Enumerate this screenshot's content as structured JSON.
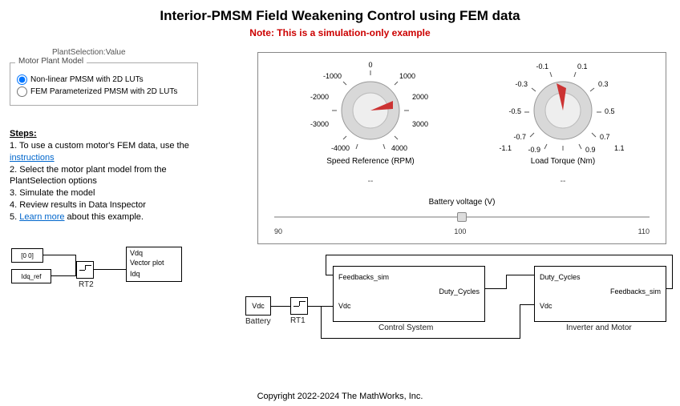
{
  "title": "Interior-PMSM Field Weakening Control using FEM data",
  "subtitle": "Note: This is a simulation-only example",
  "plant_selection_heading": "PlantSelection:Value",
  "plant_group": {
    "title": "Motor Plant Model",
    "options": [
      {
        "label": "Non-linear PMSM with 2D LUTs",
        "checked": true
      },
      {
        "label": "FEM Parameterized PMSM with 2D LUTs",
        "checked": false
      }
    ]
  },
  "steps": {
    "heading": "Steps:",
    "line1a": "1. To use a custom motor's FEM data, use the ",
    "line1_link": "instructions",
    "line2": "2. Select the motor plant model from the PlantSelection options",
    "line3": "3. Simulate the model",
    "line4": "4. Review results in Data Inspector",
    "line5a": "5. ",
    "line5_link": "Learn more",
    "line5b": " about this example."
  },
  "dashboard": {
    "speed_dial": {
      "label": "Speed Reference (RPM)",
      "value_display": "--",
      "ticks": [
        "-1000",
        "0",
        "1000",
        "-2000",
        "2000",
        "-3000",
        "3000",
        "-4000",
        "4000"
      ]
    },
    "torque_dial": {
      "label": "Load Torque (Nm)",
      "value_display": "--",
      "ticks": [
        "-0.1",
        "0.1",
        "-0.3",
        "0.3",
        "-0.5",
        "0.5",
        "-0.7",
        "0.7",
        "-0.9",
        "0.9",
        "-1.1",
        "1.1"
      ]
    },
    "slider": {
      "label": "Battery voltage (V)",
      "min": "90",
      "mid": "100",
      "max": "110",
      "position_percent": 50
    }
  },
  "blocks": {
    "constant": {
      "text": "0  0"
    },
    "idq_ref": "Idq_ref",
    "rt2": "RT2",
    "vector_plot": {
      "port1": "Vdq",
      "name": "Vector plot",
      "port2": "Idq"
    },
    "vdc_small": "Vdc",
    "battery": "Battery",
    "rt1": "RT1",
    "control_system": {
      "name": "Control System",
      "in1": "Feedbacks_sim",
      "in2": "Vdc",
      "out": "Duty_Cycles"
    },
    "inverter_motor": {
      "name": "Inverter and Motor",
      "in1": "Duty_Cycles",
      "in2": "Vdc",
      "out": "Feedbacks_sim"
    }
  },
  "copyright": "Copyright 2022-2024 The MathWorks, Inc."
}
